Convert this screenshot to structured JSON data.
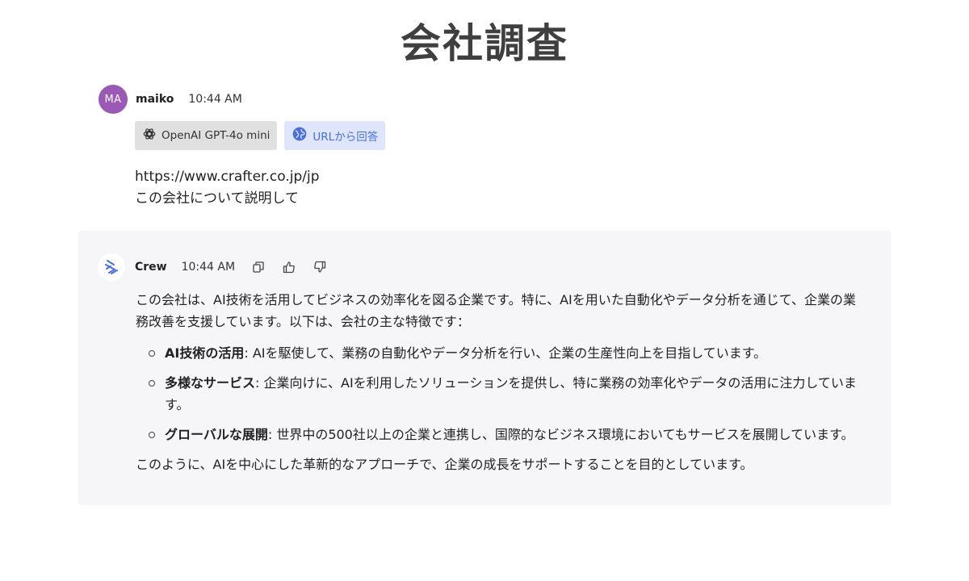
{
  "page_title": "会社調査",
  "user": {
    "avatar_initials": "MA",
    "avatar_color": "#9b59b6",
    "name": "maiko",
    "time": "10:44 AM",
    "chips": [
      {
        "label": "OpenAI GPT-4o mini",
        "icon": "openai-icon"
      },
      {
        "label": "URLから回答",
        "icon": "globe-icon"
      }
    ],
    "url_line": "https://www.crafter.co.jp/jp",
    "question_line": "この会社について説明して"
  },
  "crew": {
    "name": "Crew",
    "time": "10:44 AM",
    "actions": [
      "copy-icon",
      "thumbs-up-icon",
      "thumbs-down-icon"
    ],
    "intro": "この会社は、AI技術を活用してビジネスの効率化を図る企業です。特に、AIを用いた自動化やデータ分析を通じて、企業の業務改善を支援しています。以下は、会社の主な特徴です：",
    "bullets": [
      {
        "title": "AI技術の活用",
        "text": ": AIを駆使して、業務の自動化やデータ分析を行い、企業の生産性向上を目指しています。"
      },
      {
        "title": "多様なサービス",
        "text": ": 企業向けに、AIを利用したソリューションを提供し、特に業務の効率化やデータの活用に注力しています。"
      },
      {
        "title": "グローバルな展開",
        "text": ": 世界中の500社以上の企業と連携し、国際的なビジネス環境においてもサービスを展開しています。"
      }
    ],
    "outro": "このように、AIを中心にした革新的なアプローチで、企業の成長をサポートすることを目的としています。"
  },
  "colors": {
    "accent_blue": "#4a6fd8",
    "panel_bg": "#f6f6f8"
  }
}
